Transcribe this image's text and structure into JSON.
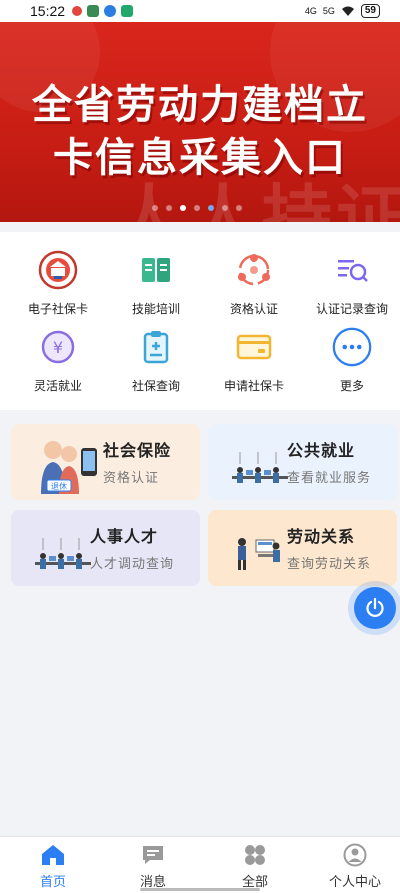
{
  "status_bar": {
    "time": "15:22",
    "network_1": "4G",
    "network_2": "5G",
    "battery": "59"
  },
  "banner": {
    "line1": "全省劳动力建档立",
    "line2": "卡信息采集入口",
    "watermark": "人人持证"
  },
  "services": [
    {
      "label": "电子社保卡",
      "icon": "social-security-card-icon"
    },
    {
      "label": "技能培训",
      "icon": "book-icon"
    },
    {
      "label": "资格认证",
      "icon": "people-circle-icon"
    },
    {
      "label": "认证记录查询",
      "icon": "list-search-icon"
    },
    {
      "label": "灵活就业",
      "icon": "yuan-icon"
    },
    {
      "label": "社保查询",
      "icon": "clipboard-icon"
    },
    {
      "label": "申请社保卡",
      "icon": "card-icon"
    },
    {
      "label": "更多",
      "icon": "more-icon"
    }
  ],
  "cards": [
    {
      "title": "社会保险",
      "subtitle": "资格认证",
      "bg": "#fbeee0"
    },
    {
      "title": "公共就业",
      "subtitle": "查看就业服务",
      "bg": "#eaf3fd"
    },
    {
      "title": "人事人才",
      "subtitle": "人才调动查询",
      "bg": "#e6e6f6"
    },
    {
      "title": "劳动关系",
      "subtitle": "查询劳动关系",
      "bg": "#fde7cf"
    }
  ],
  "card_badge": "退休",
  "tabs": [
    {
      "label": "首页",
      "icon": "home-icon",
      "active": true
    },
    {
      "label": "消息",
      "icon": "message-icon",
      "active": false
    },
    {
      "label": "全部",
      "icon": "grid-icon",
      "active": false
    },
    {
      "label": "个人中心",
      "icon": "user-icon",
      "active": false
    }
  ],
  "colors": {
    "accent": "#2c7ff2",
    "banner_red": "#d9261c"
  }
}
